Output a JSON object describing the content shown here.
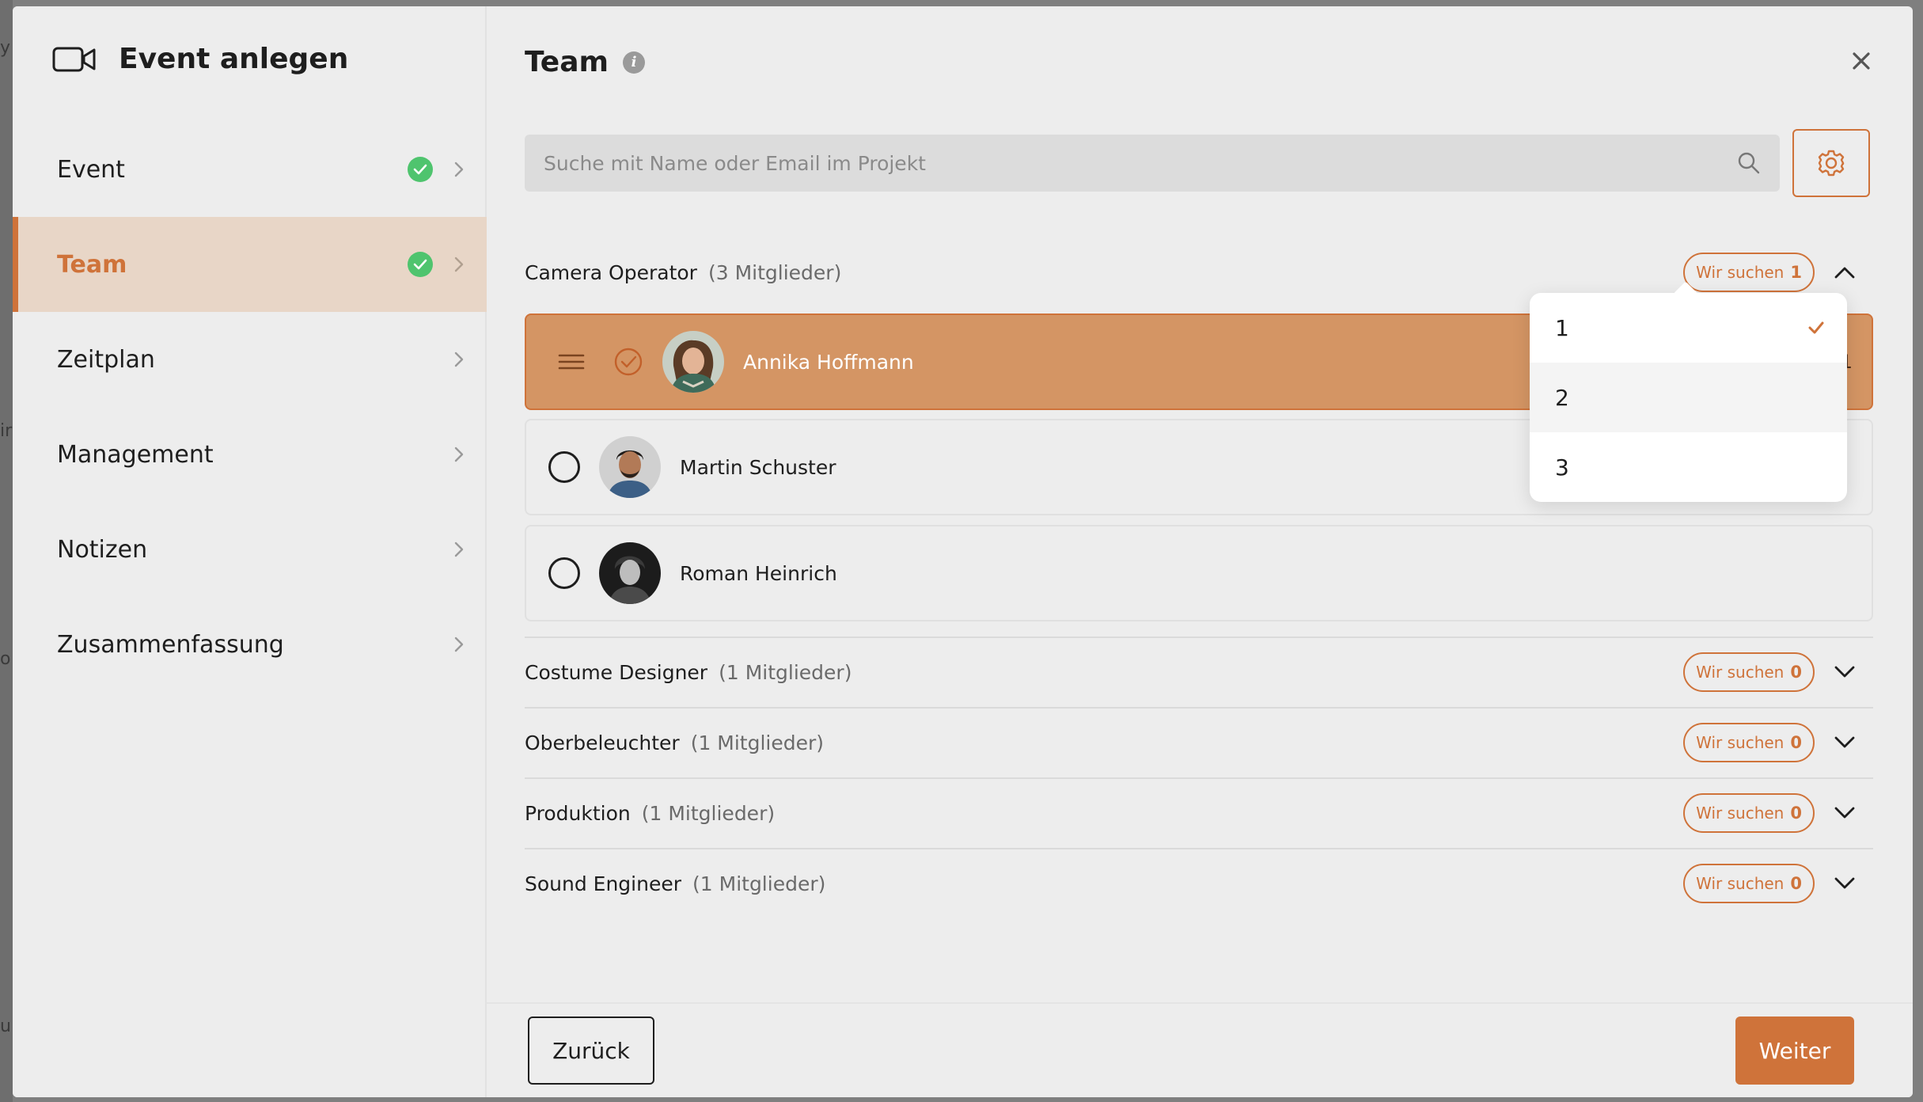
{
  "sidebar": {
    "title": "Event anlegen",
    "items": [
      {
        "label": "Event",
        "done": true,
        "active": false
      },
      {
        "label": "Team",
        "done": true,
        "active": true
      },
      {
        "label": "Zeitplan",
        "done": false,
        "active": false
      },
      {
        "label": "Management",
        "done": false,
        "active": false
      },
      {
        "label": "Notizen",
        "done": false,
        "active": false
      },
      {
        "label": "Zusammenfassung",
        "done": false,
        "active": false
      }
    ]
  },
  "main": {
    "title": "Team",
    "search_placeholder": "Suche mit Name oder Email im Projekt",
    "wir_suchen_label": "Wir suchen",
    "groups": [
      {
        "name": "Camera Operator",
        "count": "(3 Mitglieder)",
        "wanted": "1",
        "expanded": true,
        "members": [
          {
            "name": "Annika Hoffmann",
            "selected": true,
            "trailing": "1"
          },
          {
            "name": "Martin Schuster",
            "selected": false
          },
          {
            "name": "Roman Heinrich",
            "selected": false
          }
        ]
      },
      {
        "name": "Costume Designer",
        "count": "(1 Mitglieder)",
        "wanted": "0",
        "expanded": false
      },
      {
        "name": "Oberbeleuchter",
        "count": "(1 Mitglieder)",
        "wanted": "0",
        "expanded": false
      },
      {
        "name": "Produktion",
        "count": "(1 Mitglieder)",
        "wanted": "0",
        "expanded": false
      },
      {
        "name": "Sound Engineer",
        "count": "(1 Mitglieder)",
        "wanted": "0",
        "expanded": false
      }
    ]
  },
  "dropdown": {
    "options": [
      "1",
      "2",
      "3"
    ],
    "selected": "1",
    "hovered": "2"
  },
  "footer": {
    "back_label": "Zurück",
    "next_label": "Weiter"
  },
  "colors": {
    "accent": "#cf733a",
    "success": "#4fc46e",
    "active_nav_bg": "#e8d6c7",
    "selected_row_bg": "#d49564"
  },
  "backdrop": [
    "y",
    "ir",
    "o",
    "ur"
  ]
}
